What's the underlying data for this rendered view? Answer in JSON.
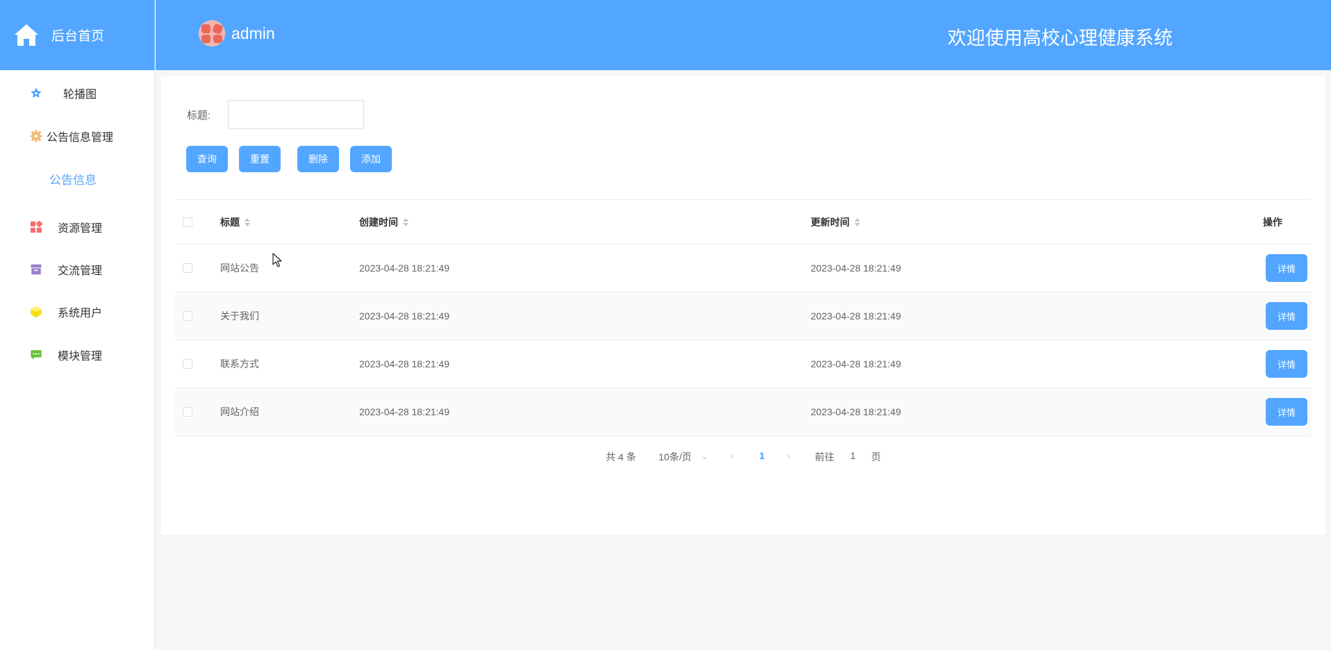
{
  "sidebar": {
    "home_label": "后台首页",
    "items": [
      {
        "label": "轮播图",
        "icon": "star-icon",
        "color": "#409eff"
      },
      {
        "label": "公告信息管理",
        "icon": "gear-icon",
        "color": "#f0b86e"
      },
      {
        "label": "资源管理",
        "icon": "grid-icon",
        "color": "#f56c6c"
      },
      {
        "label": "交流管理",
        "icon": "archive-icon",
        "color": "#9a7ec9"
      },
      {
        "label": "系统用户",
        "icon": "cube-icon",
        "color": "#f7e11a"
      },
      {
        "label": "模块管理",
        "icon": "chat-icon",
        "color": "#67c23a"
      }
    ],
    "active_sub_label": "公告信息"
  },
  "header": {
    "username": "admin",
    "title": "欢迎使用高校心理健康系统"
  },
  "search": {
    "label": "标题:",
    "value": ""
  },
  "buttons": {
    "query": "查询",
    "reset": "重置",
    "delete": "删除",
    "add": "添加"
  },
  "table": {
    "columns": [
      "标题",
      "创建时间",
      "更新时间",
      "操作"
    ],
    "rows": [
      {
        "title": "网站公告",
        "created": "2023-04-28 18:21:49",
        "updated": "2023-04-28 18:21:49",
        "action": "详情"
      },
      {
        "title": "关于我们",
        "created": "2023-04-28 18:21:49",
        "updated": "2023-04-28 18:21:49",
        "action": "详情"
      },
      {
        "title": "联系方式",
        "created": "2023-04-28 18:21:49",
        "updated": "2023-04-28 18:21:49",
        "action": "详情"
      },
      {
        "title": "网站介绍",
        "created": "2023-04-28 18:21:49",
        "updated": "2023-04-28 18:21:49",
        "action": "详情"
      }
    ]
  },
  "pagination": {
    "total": "共 4 条",
    "page_size": "10条/页",
    "current_page": "1",
    "goto_prefix": "前往",
    "goto_value": "1",
    "goto_suffix": "页"
  },
  "colors": {
    "primary": "#53a6ff",
    "active_text": "#409eff"
  }
}
